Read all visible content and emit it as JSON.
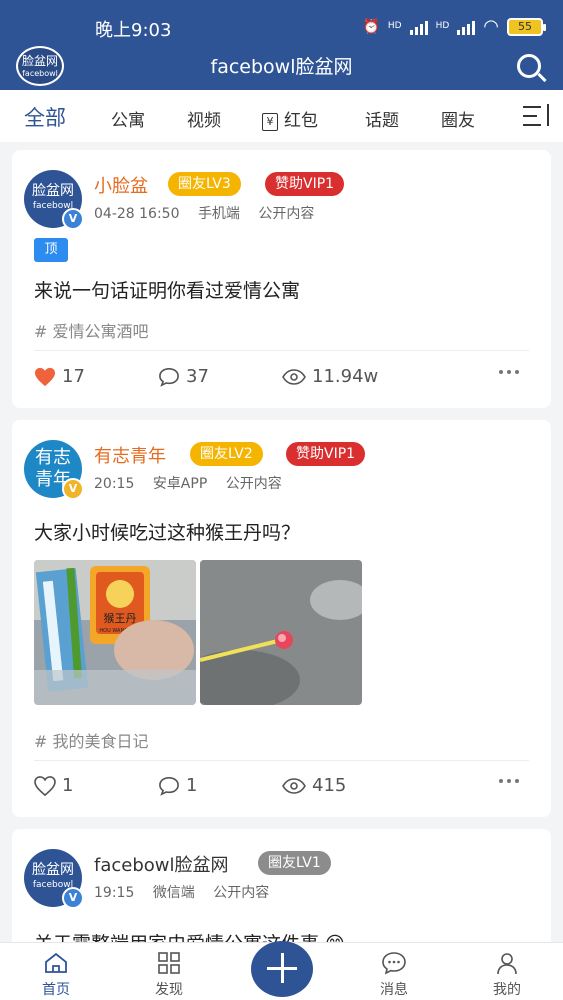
{
  "status": {
    "time": "晚上9:03",
    "hd1": "HD",
    "hd2": "HD",
    "battery": "55"
  },
  "appbar": {
    "logo_line1": "脸盆网",
    "logo_line2": "facebowl",
    "title": "facebowl脸盆网"
  },
  "tabs": [
    "全部",
    "公寓",
    "视频",
    "红包",
    "话题",
    "圈友"
  ],
  "redpack_glyph": "¥",
  "posts": [
    {
      "avatar_line1": "脸盆网",
      "avatar_line2": "facebowl",
      "username": "小脸盆",
      "level": "圈友LV3",
      "vip": "赞助VIP1",
      "date": "04-28 16:50",
      "device": "手机端",
      "visibility": "公开内容",
      "pin": "顶",
      "title": "来说一句话证明你看过爱情公寓",
      "topic": "# 爱情公寓酒吧",
      "likes": "17",
      "comments": "37",
      "views": "11.94w"
    },
    {
      "avatar_line1": "有志",
      "avatar_line2": "青年",
      "username": "有志青年",
      "level": "圈友LV2",
      "vip": "赞助VIP1",
      "date": "20:15",
      "device": "安卓APP",
      "visibility": "公开内容",
      "title": "大家小时候吃过这种猴王丹吗？",
      "topic": "# 我的美食日记",
      "likes": "1",
      "comments": "1",
      "views": "415",
      "image_text": "猴王丹",
      "image_text_small": "HOU WANG DAN"
    },
    {
      "avatar_line1": "脸盆网",
      "avatar_line2": "facebowl",
      "username": "facebowl脸盆网",
      "level": "圈友LV1",
      "date": "19:15",
      "device": "微信端",
      "visibility": "公开内容",
      "title": "关于霍整端用家史爱情公寓这件事 😊"
    }
  ],
  "bottom_nav": [
    "首页",
    "发现",
    "消息",
    "我的"
  ],
  "colors": {
    "primary": "#2f5496",
    "level": "#f5b400",
    "vip": "#d92f2f",
    "like": "#f0623b"
  }
}
